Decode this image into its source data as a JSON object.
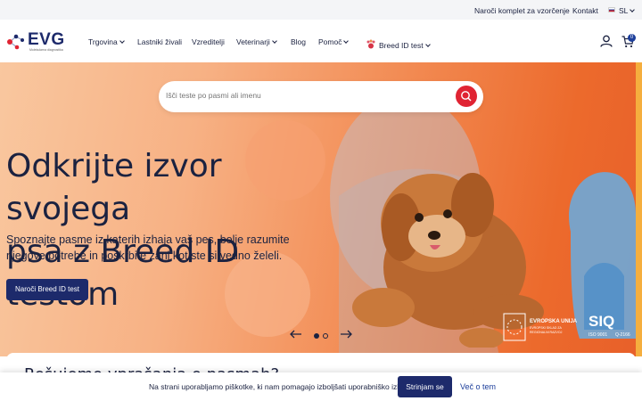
{
  "topbar": {
    "order_kit": "Naroči komplet za vzorčenje",
    "contact": "Kontakt",
    "language": "SL"
  },
  "brand": {
    "name": "EVG",
    "tagline": "Molekularna diagnostika",
    "primary_color": "#1d2a6b",
    "accent_color": "#e02433"
  },
  "nav": {
    "items": [
      {
        "label": "Trgovina",
        "has_dropdown": true
      },
      {
        "label": "Lastniki živali",
        "has_dropdown": false
      },
      {
        "label": "Vzreditelji",
        "has_dropdown": false
      },
      {
        "label": "Veterinarji",
        "has_dropdown": true
      },
      {
        "label": "Blog",
        "has_dropdown": false
      },
      {
        "label": "Pomoč",
        "has_dropdown": true
      }
    ],
    "breed_id": "Breed ID test",
    "cart_count": "0",
    "icons": [
      "user-icon",
      "cart-icon"
    ]
  },
  "hero": {
    "search_placeholder": "Išči teste po pasmi ali imenu",
    "title_line1": "Odkrijte izvor svojega",
    "title_line2": "psa z Breed ID testom",
    "lead": "Spoznajte pasme iz katerih izhaja vaš pes, bolje razumite njegove potrebe in poskrbite zanj kot ste si vedno želeli.",
    "cta": "Naroči Breed ID test",
    "slides": {
      "total": 2,
      "active": 1
    },
    "eu_badge": "EVROPSKA UNIJA",
    "eu_sub": "EVROPSKI SKLAD ZA REGIONALNI RAZVOJ",
    "iso_label": "SIQ",
    "iso_1": "ISO 9001",
    "iso_2": "Q-2166"
  },
  "section": {
    "title_partial": "Rešujemo vprašanja o pasmah?"
  },
  "cookie": {
    "text": "Na strani uporabljamo piškotke, ki nam pomagajo izboljšati uporabniško izkušnjo.",
    "accept": "Strinjam se",
    "more": "Več o tem"
  }
}
